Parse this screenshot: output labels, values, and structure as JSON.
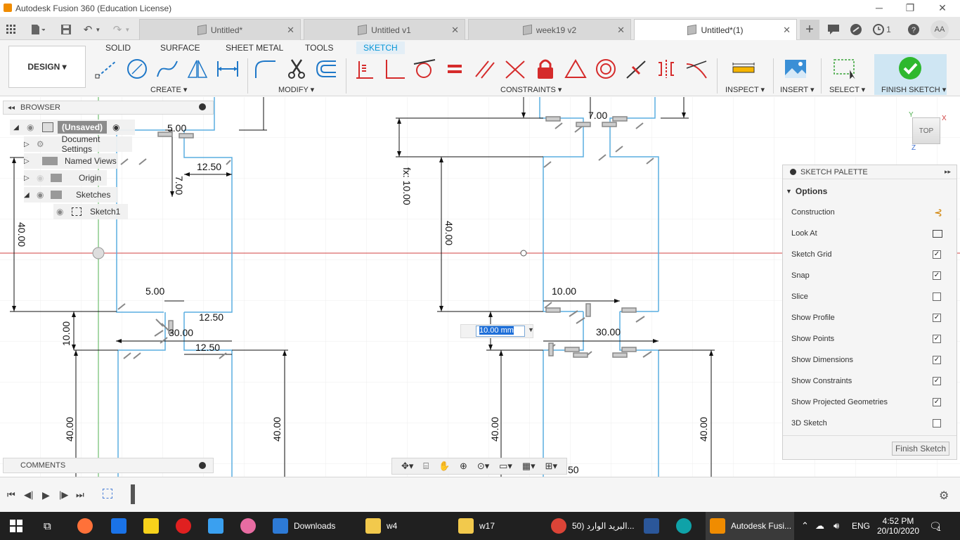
{
  "window": {
    "title": "Autodesk Fusion 360 (Education License)",
    "minimize": "─",
    "restore": "❐",
    "close": "✕"
  },
  "tabs": [
    {
      "label": "Untitled*",
      "active": false
    },
    {
      "label": "Untitled v1",
      "active": false
    },
    {
      "label": "week19 v2",
      "active": false
    },
    {
      "label": "Untitled*(1)",
      "active": true
    }
  ],
  "quick": {
    "new_tab": "+",
    "job_count": "1",
    "user": "AA"
  },
  "ribbon": {
    "tabs": [
      "SOLID",
      "SURFACE",
      "SHEET METAL",
      "TOOLS",
      "SKETCH"
    ],
    "workspace": "DESIGN ▾",
    "groups": {
      "create": "CREATE ▾",
      "modify": "MODIFY ▾",
      "constraints": "CONSTRAINTS ▾",
      "inspect": "INSPECT ▾",
      "insert": "INSERT ▾",
      "select": "SELECT ▾",
      "finish": "FINISH SKETCH ▾"
    }
  },
  "browser": {
    "title": "BROWSER",
    "root": "(Unsaved)",
    "items": [
      "Document Settings",
      "Named Views",
      "Origin",
      "Sketches",
      "Sketch1"
    ]
  },
  "comments": {
    "title": "COMMENTS"
  },
  "viewcube": {
    "label": "TOP",
    "x": "X",
    "y": "Y",
    "z": "Z"
  },
  "dimensions": {
    "left": [
      "5.00",
      "7.00",
      "12.50",
      "40.00",
      "5.00",
      "12.50",
      "30.00",
      "12.50",
      "10.00",
      "40.00",
      "40.00"
    ],
    "right": [
      "7.00",
      "fx: 10.00",
      "40.00",
      "10.00",
      "30.00",
      "40.00",
      "40.00",
      "50"
    ]
  },
  "dim_input": {
    "value": "10.00 mm"
  },
  "palette": {
    "title": "SKETCH PALETTE",
    "section": "Options",
    "rows": [
      {
        "label": "Construction",
        "type": "icon"
      },
      {
        "label": "Look At",
        "type": "icon"
      },
      {
        "label": "Sketch Grid",
        "checked": true
      },
      {
        "label": "Snap",
        "checked": true
      },
      {
        "label": "Slice",
        "checked": false
      },
      {
        "label": "Show Profile",
        "checked": true
      },
      {
        "label": "Show Points",
        "checked": true
      },
      {
        "label": "Show Dimensions",
        "checked": true
      },
      {
        "label": "Show Constraints",
        "checked": true
      },
      {
        "label": "Show Projected Geometries",
        "checked": true
      },
      {
        "label": "3D Sketch",
        "checked": false
      }
    ],
    "finish_button": "Finish Sketch"
  },
  "taskbar": {
    "items": [
      {
        "label": "Downloads",
        "color": "#2d7ad6"
      },
      {
        "label": "w4",
        "color": "#f2c94c"
      },
      {
        "label": "w17",
        "color": "#f2c94c"
      },
      {
        "label": "البريد الوارد (50...",
        "color": "#db4437"
      },
      {
        "label": "Autodesk Fusi...",
        "color": "#f08c00"
      }
    ],
    "lang": "ENG",
    "time": "4:52 PM",
    "date": "20/10/2020",
    "notif": "1"
  },
  "colors": {
    "accent": "#0696d7",
    "sketch_line": "#5aaee0",
    "dimension": "#000000",
    "axis_red": "#d04040",
    "axis_green": "#50b050"
  }
}
